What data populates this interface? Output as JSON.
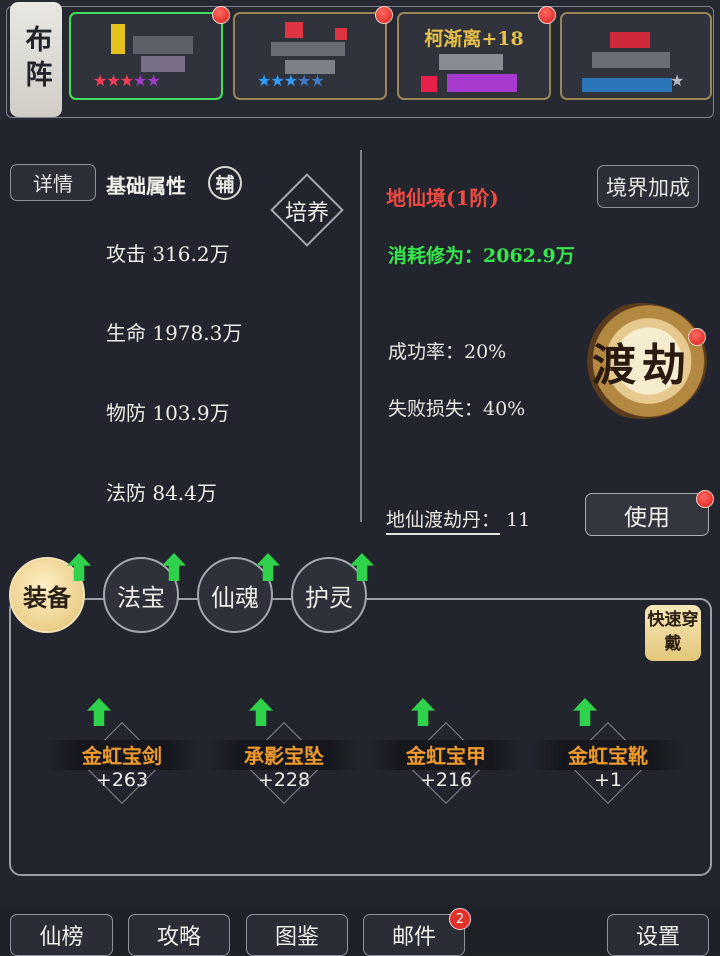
{
  "topbar": {
    "lineup_label": "布阵",
    "cards": [
      {
        "name": "",
        "stars": "★★★★★",
        "selected": true
      },
      {
        "name": "",
        "stars": "★★★★★",
        "selected": false
      },
      {
        "name": "柯渐离+18",
        "stars": "",
        "selected": false
      },
      {
        "name": "",
        "stars": "★",
        "selected": false
      }
    ]
  },
  "stats": {
    "details_label": "详情",
    "title": "基础属性",
    "support_badge": "辅",
    "cultivate_label": "培养",
    "attack": "攻击 316.2万",
    "hp": "生命 1978.3万",
    "phys_def": "物防 103.9万",
    "magic_def": "法防 84.4万"
  },
  "realm": {
    "name": "地仙境(1阶)",
    "bonus_label": "境界加成",
    "cost": "消耗修为：2062.9万",
    "success_rate": "成功率：20%",
    "fail_loss": "失败损失：40%",
    "tribulation_label": "渡劫",
    "pill": "地仙渡劫丹：",
    "pill_count": "11",
    "use_label": "使用"
  },
  "tabs": [
    "装备",
    "法宝",
    "仙魂",
    "护灵"
  ],
  "quick_wear_label": "快速穿戴",
  "equipment": [
    {
      "name": "金虹宝剑",
      "level": "+263"
    },
    {
      "name": "承影宝坠",
      "level": "+228"
    },
    {
      "name": "金虹宝甲",
      "level": "+216"
    },
    {
      "name": "金虹宝靴",
      "level": "+1"
    }
  ],
  "bottom_nav": {
    "ranking": "仙榜",
    "guide": "攻略",
    "codex": "图鉴",
    "mail": "邮件",
    "mail_count": "2",
    "settings": "设置"
  },
  "colors": {
    "background": "#22252d",
    "realm_red": "#f04a42",
    "cost_green": "#36e84e",
    "equip_orange": "#f09a2c",
    "selected_green": "#3fe05a",
    "upgrade_arrow": "#2fd24a"
  }
}
